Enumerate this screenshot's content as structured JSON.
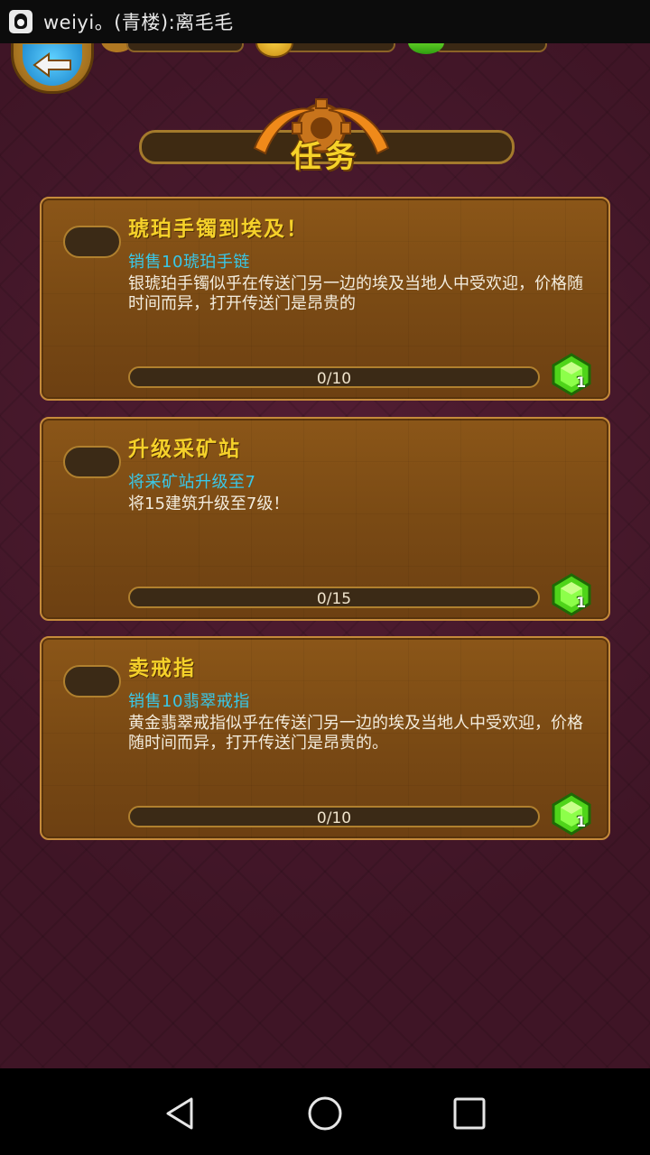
{
  "status_bar": {
    "notification_text": "weiyi。(青楼):离毛毛"
  },
  "header": {
    "title": "任务"
  },
  "quests": [
    {
      "title": "琥珀手镯到埃及！",
      "subtitle": "销售10琥珀手链",
      "description": "银琥珀手镯似乎在传送门另一边的埃及当地人中受欢迎，价格随时间而异，打开传送门是昂贵的",
      "progress_text": "0/10",
      "progress_fraction": 0,
      "reward_count": "1"
    },
    {
      "title": "升级采矿站",
      "subtitle": "将采矿站升级至7",
      "description": "将15建筑升级至7级！",
      "progress_text": "0/15",
      "progress_fraction": 0,
      "reward_count": "1"
    },
    {
      "title": "卖戒指",
      "subtitle": "销售10翡翠戒指",
      "description": "黄金翡翠戒指似乎在传送门另一边的埃及当地人中受欢迎，价格随时间而异，打开传送门是昂贵的。",
      "progress_text": "0/10",
      "progress_fraction": 0,
      "reward_count": "1"
    }
  ],
  "colors": {
    "title": "#f5d12a",
    "subtitle": "#39c8e8",
    "description": "#f3ecdd",
    "card_border": "#c58a3a",
    "background": "#43182a"
  },
  "icons": {
    "back": "back-arrow-icon",
    "reward": "green-gem-icon",
    "nav_back": "triangle-back-icon",
    "nav_home": "circle-home-icon",
    "nav_recents": "square-recents-icon"
  }
}
